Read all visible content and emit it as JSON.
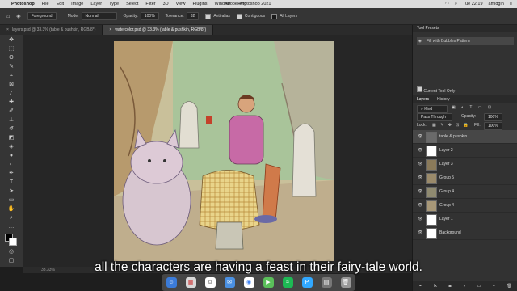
{
  "menubar": {
    "app": "Photoshop",
    "items": [
      "File",
      "Edit",
      "Image",
      "Layer",
      "Type",
      "Select",
      "Filter",
      "3D",
      "View",
      "Plugins",
      "Window",
      "Help"
    ],
    "window_title": "Adobe Photoshop 2021",
    "clock": "Tue 22:19",
    "user": "amidgin"
  },
  "options": {
    "target": "Foreground",
    "mode_label": "Mode:",
    "mode": "Normal",
    "opacity_label": "Opacity:",
    "opacity": "100%",
    "tolerance_label": "Tolerance:",
    "tolerance": "32",
    "antialias": "Anti-alias",
    "contiguous": "Contiguous",
    "all_layers": "All Layers"
  },
  "tabs": [
    {
      "label": "layers.psd @ 33.3% (table & pushkin, RGB/8*)"
    },
    {
      "label": "watercolor.psd @ 33.3% (table & pushkin, RGB/8*)"
    }
  ],
  "status": "33.33%",
  "tool_presets": {
    "title": "Tool Presets",
    "item": "Fill with Bubbles Pattern",
    "current_only": "Current Tool Only"
  },
  "layers_panel": {
    "tab_layers": "Layers",
    "tab_history": "History",
    "kind": "Kind",
    "blend": "Pass Through",
    "opacity_label": "Opacity:",
    "opacity": "100%",
    "lock_label": "Lock:",
    "fill_label": "Fill:",
    "fill": "100%",
    "layers": [
      {
        "name": "table & pushkin",
        "color": "#6a6a6a"
      },
      {
        "name": "Layer 2",
        "color": "#ffffff"
      },
      {
        "name": "Layer 3",
        "color": "#8a7a5a"
      },
      {
        "name": "Group 5",
        "color": "#9a8a6a"
      },
      {
        "name": "Group 4",
        "color": "#8f8a70"
      },
      {
        "name": "Group 4",
        "color": "#a89878"
      },
      {
        "name": "Layer 1",
        "color": "#ffffff"
      },
      {
        "name": "Background",
        "color": "#ffffff"
      }
    ]
  },
  "subtitle": "all the characters are having a feast in their fairy-tale world."
}
